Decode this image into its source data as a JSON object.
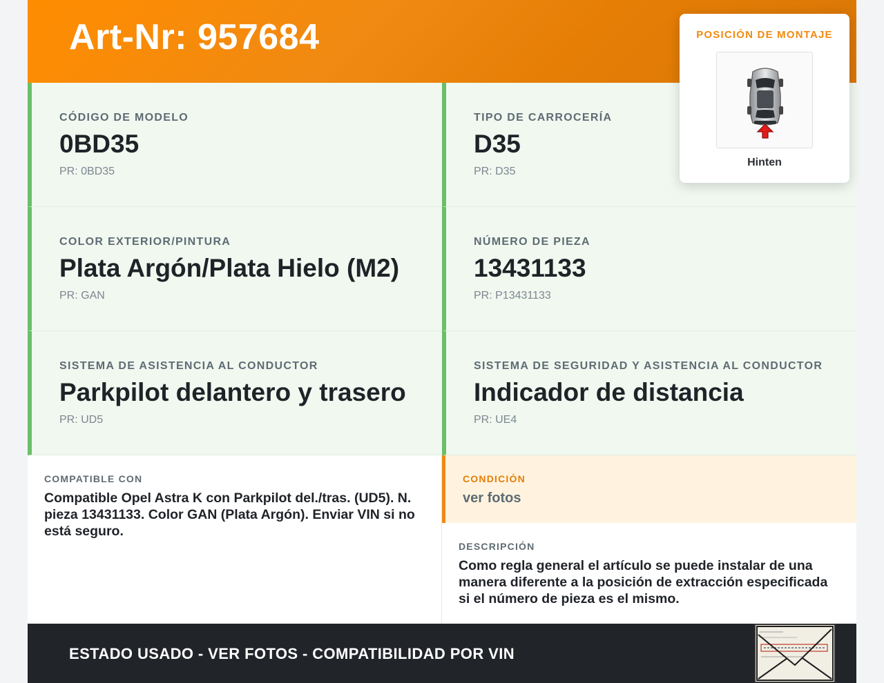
{
  "header": {
    "title": "Art-Nr: 957684"
  },
  "fields": [
    {
      "label": "CÓDIGO DE MODELO",
      "value": "0BD35",
      "pr": "PR: 0BD35"
    },
    {
      "label": "TIPO DE CARROCERÍA",
      "value": "D35",
      "pr": "PR: D35"
    },
    {
      "label": "COLOR EXTERIOR/PINTURA",
      "value": "Plata Argón/Plata Hielo (M2)",
      "pr": "PR: GAN"
    },
    {
      "label": "NÚMERO DE PIEZA",
      "value": "13431133",
      "pr": "PR: P13431133"
    },
    {
      "label": "SISTEMA DE ASISTENCIA AL CONDUCTOR",
      "value": "Parkpilot delantero y trasero",
      "pr": "PR: UD5"
    },
    {
      "label": "SISTEMA DE SEGURIDAD Y ASISTENCIA AL CONDUCTOR",
      "value": "Indicador de distancia",
      "pr": "PR: UE4"
    }
  ],
  "mounting": {
    "title": "POSICIÓN DE MONTAJE",
    "position": "Hinten",
    "icon": "car-top-view-rear-arrow-icon"
  },
  "compatible": {
    "label": "COMPATIBLE CON",
    "text": "Compatible Opel Astra K con Parkpilot del./tras. (UD5). N. pieza 13431133. Color GAN (Plata Argón). Enviar VIN si no está seguro."
  },
  "condition": {
    "label": "CONDICIÓN",
    "value": "ver fotos"
  },
  "description": {
    "label": "DESCRIPCIÓN",
    "text": "Como regla general el artículo se puede instalar de una manera diferente a la posición de extracción especificada si el número de pieza es el mismo."
  },
  "footer": {
    "text": "ESTADO USADO - VER FOTOS - COMPATIBILIDAD POR VIN",
    "stamp_icon": "vin-label-envelope-image"
  },
  "colors": {
    "accent": "#f08a12",
    "cell_bg": "#f0f8f0",
    "cell_border": "#6abf69",
    "footer_bg": "#212429",
    "condition_bg": "#fff3e0"
  }
}
